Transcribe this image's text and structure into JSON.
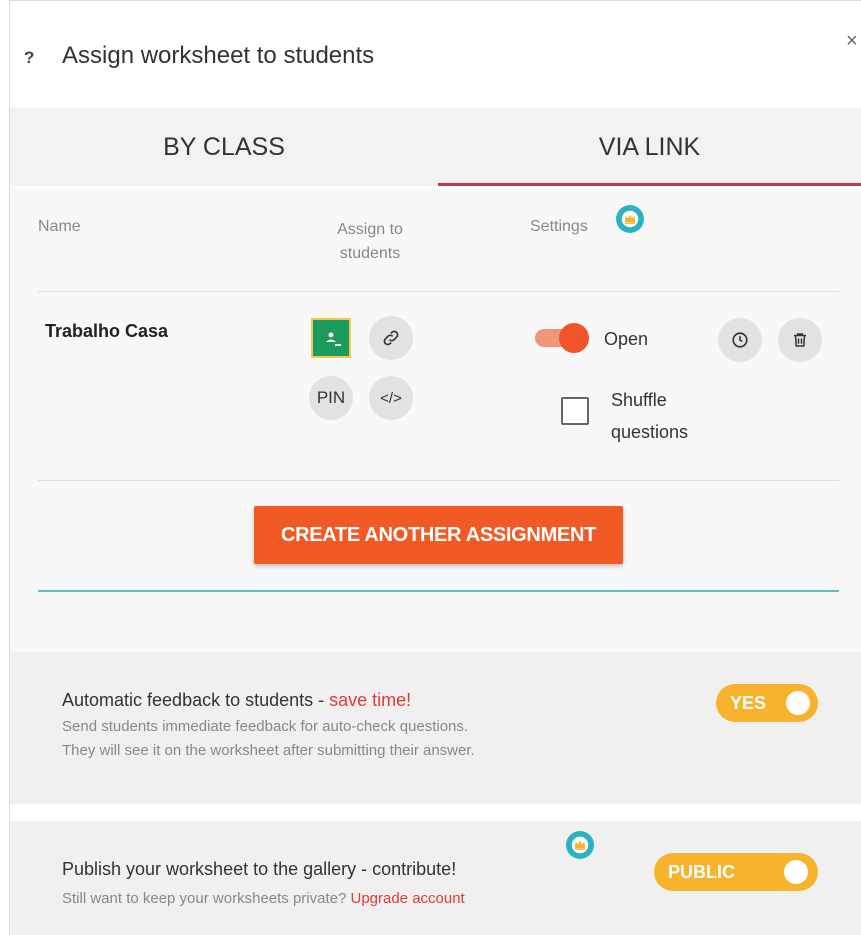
{
  "dialog": {
    "help_icon": "?",
    "title": "Assign worksheet to students",
    "close_icon": "×"
  },
  "tabs": {
    "by_class": "BY CLASS",
    "via_link": "VIA LINK",
    "active": "VIA LINK"
  },
  "table": {
    "headers": {
      "name": "Name",
      "assign_line1": "Assign to",
      "assign_line2": "students",
      "settings": "Settings"
    },
    "rows": [
      {
        "name": "Trabalho Casa",
        "pin_label": "PIN",
        "embed_label": "</>",
        "status_label": "Open",
        "status_on": true,
        "shuffle_line1": "Shuffle",
        "shuffle_line2": "questions",
        "shuffle_checked": false
      }
    ]
  },
  "create_button": "CREATE ANOTHER ASSIGNMENT",
  "feedback": {
    "title_main": "Automatic feedback to students - ",
    "title_highlight": "save time!",
    "desc_line1": "Send students immediate feedback for auto-check questions.",
    "desc_line2": "They will see it on the worksheet after submitting their answer.",
    "toggle_label": "YES",
    "toggle_on": true
  },
  "publish": {
    "title": "Publish your worksheet to the gallery - contribute!",
    "desc": "Still want to keep your worksheets private? ",
    "upgrade_link": "Upgrade account",
    "toggle_label": "PUBLIC",
    "toggle_on": true
  },
  "colors": {
    "accent_orange": "#f15a24",
    "tab_underline": "#c0394b",
    "teal": "#5cbfc8",
    "pill_yellow": "#f7b32b",
    "classroom_green": "#1a9a5b",
    "highlight_red": "#e53935"
  },
  "icons": {
    "crown": "crown-icon",
    "classroom": "google-classroom-icon",
    "link": "link-icon",
    "clock": "clock-icon",
    "trash": "trash-icon"
  }
}
